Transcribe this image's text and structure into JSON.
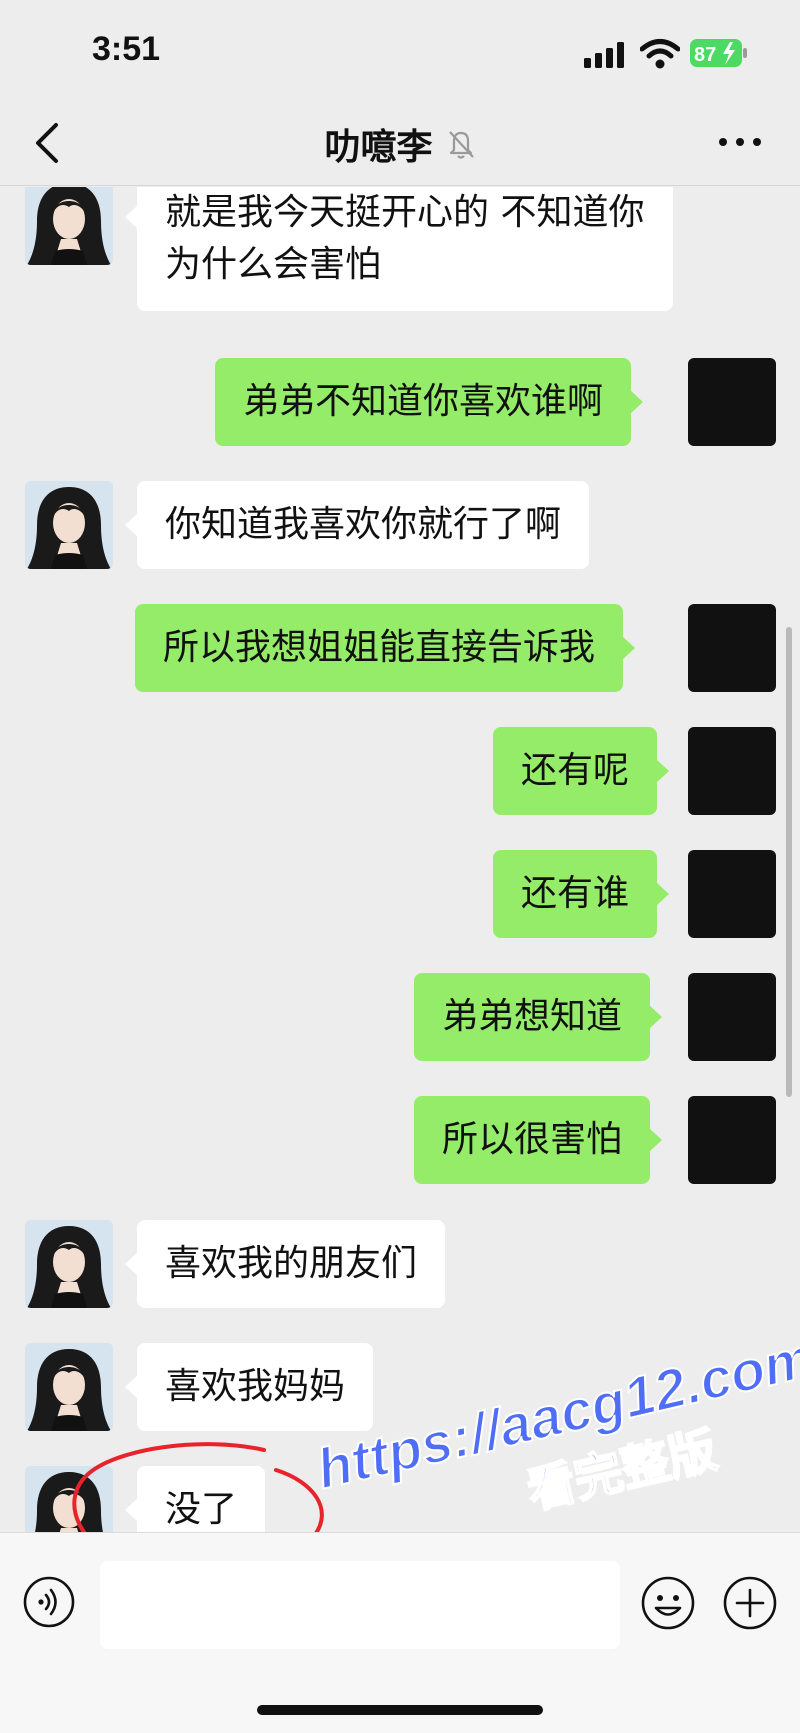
{
  "status_bar": {
    "time": "3:51",
    "battery_level": "87"
  },
  "header": {
    "title": "叻噫李"
  },
  "messages": [
    {
      "side": "in",
      "text": "就是我今天挺开心的 不知道你为什么会害怕"
    },
    {
      "side": "out",
      "text": "弟弟不知道你喜欢谁啊"
    },
    {
      "side": "in",
      "text": "你知道我喜欢你就行了啊"
    },
    {
      "side": "out",
      "text": "所以我想姐姐能直接告诉我"
    },
    {
      "side": "out",
      "text": "还有呢"
    },
    {
      "side": "out",
      "text": "还有谁"
    },
    {
      "side": "out",
      "text": "弟弟想知道"
    },
    {
      "side": "out",
      "text": "所以很害怕"
    },
    {
      "side": "in",
      "text": "喜欢我的朋友们"
    },
    {
      "side": "in",
      "text": "喜欢我妈妈"
    },
    {
      "side": "in",
      "text": "没了"
    }
  ],
  "watermark": {
    "url": "https://aacg12.com",
    "subtitle": "看完整版"
  },
  "input_bar": {
    "placeholder": ""
  },
  "colors": {
    "background": "#ededed",
    "incoming_bubble": "#ffffff",
    "outgoing_bubble": "#95ec69",
    "battery_green": "#4cd964",
    "annotation_red": "#e8232b",
    "watermark_blue": "#4f6ef5"
  },
  "icons": [
    "back-icon",
    "mute-icon",
    "more-icon",
    "voice-icon",
    "emoji-icon",
    "plus-icon",
    "signal-icon",
    "wifi-icon",
    "battery-icon"
  ]
}
